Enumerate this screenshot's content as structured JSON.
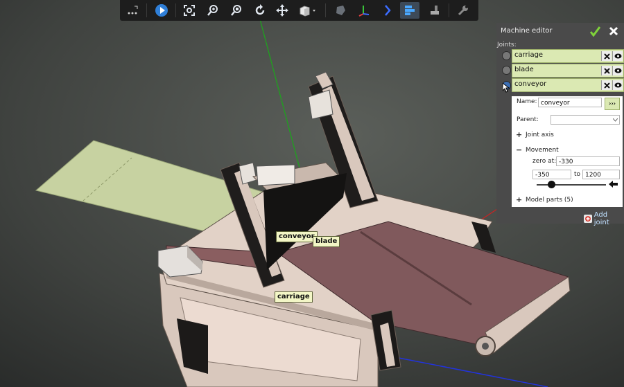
{
  "toolbar": {
    "buttons": [
      {
        "name": "more-options",
        "icon": "more-icon"
      },
      {
        "name": "play",
        "icon": "play-icon"
      },
      {
        "name": "zoom-fit",
        "icon": "zoom-fit-icon"
      },
      {
        "name": "zoom-in",
        "icon": "zoom-in-icon"
      },
      {
        "name": "zoom-region",
        "icon": "zoom-region-icon"
      },
      {
        "name": "rotate",
        "icon": "rotate-icon"
      },
      {
        "name": "pan",
        "icon": "pan-icon"
      },
      {
        "name": "view-cube",
        "icon": "cube-icon"
      },
      {
        "name": "shading",
        "icon": "shading-icon"
      },
      {
        "name": "axes",
        "icon": "axes-icon"
      },
      {
        "name": "collapse",
        "icon": "chevron-right-icon"
      },
      {
        "name": "machine-editor",
        "icon": "machine-editor-icon"
      },
      {
        "name": "tool",
        "icon": "tool-icon"
      },
      {
        "name": "settings",
        "icon": "wrench-icon"
      }
    ]
  },
  "scene": {
    "tags": {
      "conveyor": "conveyor",
      "blade": "blade",
      "carriage": "carriage"
    }
  },
  "editor": {
    "title": "Machine editor",
    "joints_label": "Joints:",
    "joints": [
      {
        "name": "carriage"
      },
      {
        "name": "blade"
      },
      {
        "name": "conveyor"
      }
    ],
    "selected": {
      "name_label": "Name:",
      "name_value": "conveyor",
      "go_label": "›››",
      "parent_label": "Parent:",
      "parent_value": "",
      "joint_axis_label": "Joint axis",
      "movement_label": "Movement",
      "zero_at_label": "zero at:",
      "zero_at_value": "-330",
      "min_value": "-350",
      "to_label": "to",
      "max_value": "1200",
      "model_parts_label": "Model parts (5)",
      "expand_plus": "+",
      "collapse_minus": "−"
    },
    "add_joint_label": "Add joint",
    "accent": "#dbe9b3"
  }
}
